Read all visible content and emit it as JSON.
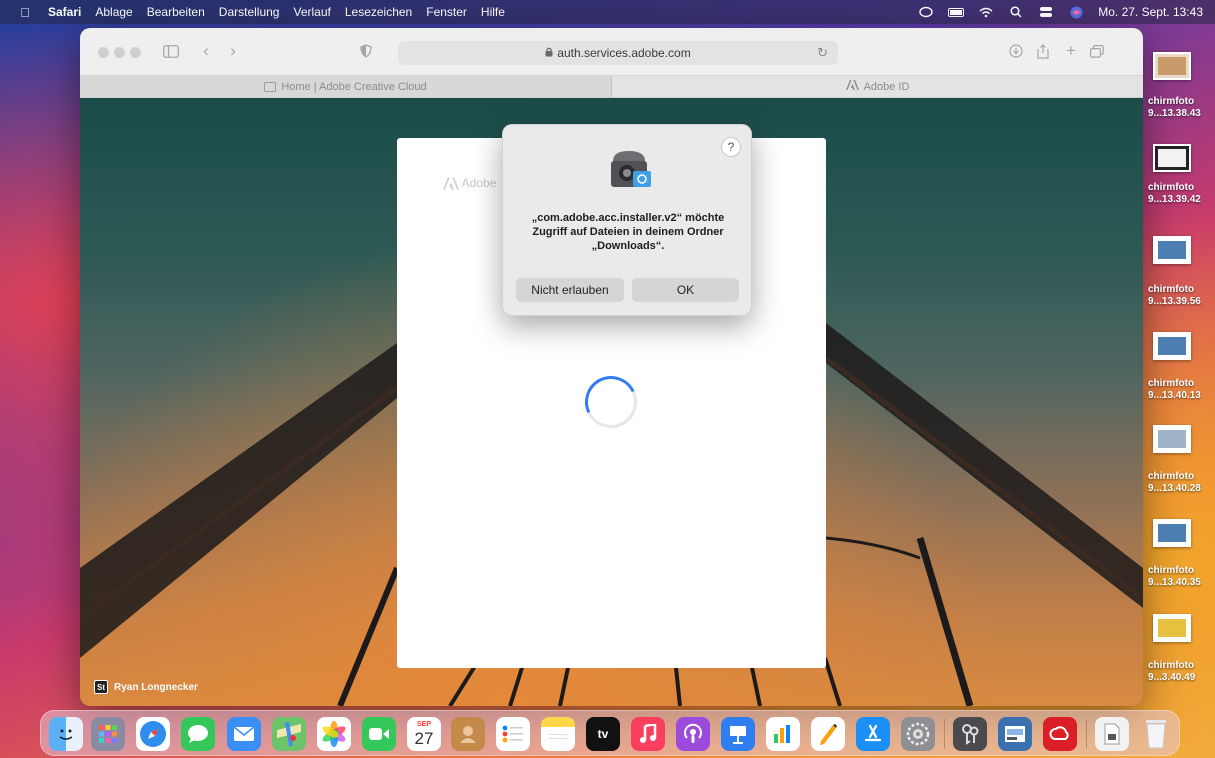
{
  "menubar": {
    "app": "Safari",
    "menus": [
      "Ablage",
      "Bearbeiten",
      "Darstellung",
      "Verlauf",
      "Lesezeichen",
      "Fenster",
      "Hilfe"
    ],
    "clock": "Mo. 27. Sept. 13:43"
  },
  "safari": {
    "url": "auth.services.adobe.com",
    "tabs": [
      {
        "title": "Home | Adobe Creative Cloud"
      },
      {
        "title": "Adobe ID"
      }
    ]
  },
  "page": {
    "photo_credit": "Ryan Longnecker",
    "st_badge": "St",
    "adobe_mark": "Adobe"
  },
  "dialog": {
    "help": "?",
    "message": "„com.adobe.acc.installer.v2“ möchte Zugriff auf Dateien in deinem Ordner „Downloads“.",
    "deny_label": "Nicht erlauben",
    "ok_label": "OK"
  },
  "desktop": {
    "items": [
      {
        "line1": "chirmfoto",
        "line2": "9...13.38.43"
      },
      {
        "line1": "chirmfoto",
        "line2": "9...13.39.42"
      },
      {
        "line1": "chirmfoto",
        "line2": "9...13.39.56"
      },
      {
        "line1": "chirmfoto",
        "line2": "9...13.40.13"
      },
      {
        "line1": "chirmfoto",
        "line2": "9...13.40.28"
      },
      {
        "line1": "chirmfoto",
        "line2": "9...13.40.35"
      },
      {
        "line1": "chirmfoto",
        "line2": "9...3.40.49"
      }
    ]
  },
  "dock": {
    "calendar_month": "SEP",
    "calendar_day": "27",
    "tv_label": "tv",
    "apps": [
      "finder-icon",
      "launchpad-icon",
      "safari-icon",
      "messages-icon",
      "mail-icon",
      "maps-icon",
      "photos-icon",
      "facetime-icon",
      "calendar-icon",
      "contacts-icon",
      "reminders-icon",
      "notes-icon",
      "tv-icon",
      "music-icon",
      "podcasts-icon",
      "keynote-icon",
      "numbers-icon",
      "pages-icon",
      "app-store-icon",
      "system-preferences-icon",
      "keychain-icon",
      "preview-icon",
      "creative-cloud-icon",
      "downloads-stack-icon",
      "trash-icon"
    ]
  }
}
